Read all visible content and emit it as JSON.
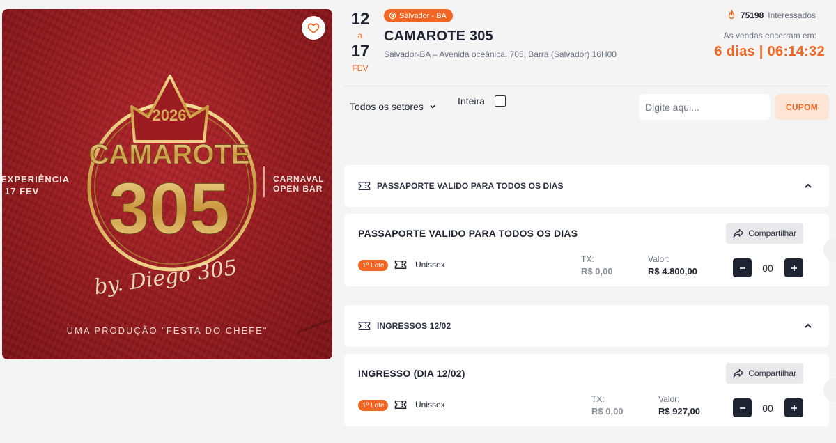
{
  "poster": {
    "year": "2026",
    "name": "CAMAROTE",
    "number": "305",
    "signature": "by. Diego 305",
    "left_text_1": "EXPERIÊNCIA",
    "left_text_2": "17 FEV",
    "right_text_1": "CARNAVAL",
    "right_text_2": "OPEN BAR",
    "footer": "UMA PRODUÇÃO \"FESTA DO CHEFE\""
  },
  "event": {
    "date_start": "12",
    "date_sep": "a",
    "date_end": "17",
    "month": "FEV",
    "location_badge": "Salvador - BA",
    "title": "CAMAROTE 305",
    "subtitle": "Salvador-BA – Avenida oceânica, 705, Barra (Salvador) 16H00",
    "interested_count": "75198",
    "interested_label": "Interessados",
    "ends_label": "As vendas encerram em:",
    "countdown": "6 dias | 06:14:32"
  },
  "filters": {
    "sector": "Todos os setores",
    "inteira_label": "Inteira",
    "coupon_placeholder": "Digite aqui...",
    "coupon_button": "CUPOM"
  },
  "sections": [
    {
      "header": "PASSAPORTE VALIDO PARA TODOS OS DIAS",
      "ticket": {
        "name": "PASSAPORTE VALIDO PARA TODOS OS DIAS",
        "share": "Compartilhar",
        "lote": "1º Lote",
        "gender": "Unissex",
        "fee_label": "TX:",
        "fee_value": "R$ 0,00",
        "price_label": "Valor:",
        "price_value": "R$ 4.800,00",
        "qty": "00"
      }
    },
    {
      "header": "INGRESSOS 12/02",
      "ticket": {
        "name": "INGRESSO (DIA 12/02)",
        "share": "Compartilhar",
        "lote": "1º Lote",
        "gender": "Unissex",
        "fee_label": "TX:",
        "fee_value": "R$ 0,00",
        "price_label": "Valor:",
        "price_value": "R$ 927,00",
        "qty": "00"
      }
    }
  ],
  "colors": {
    "accent": "#f26522",
    "dark": "#1f2433",
    "poster_red": "#9a1c20",
    "gold": "#d9b25a"
  }
}
